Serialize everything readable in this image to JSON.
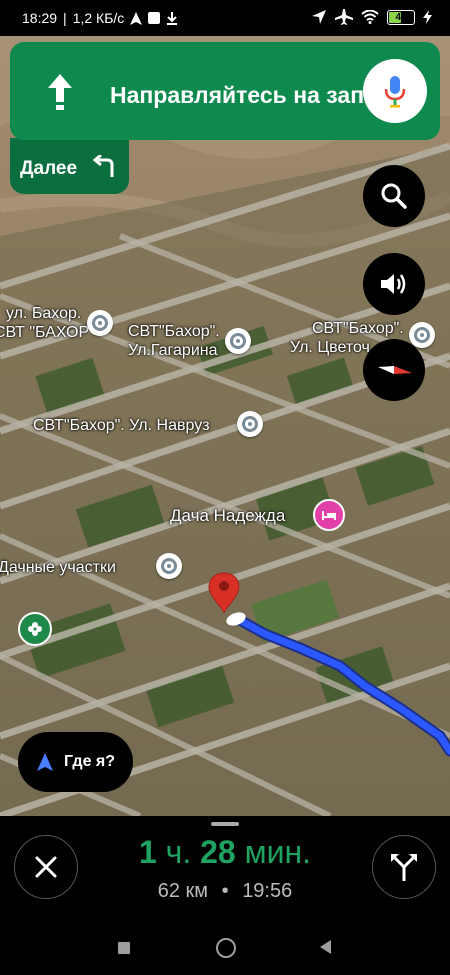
{
  "status_bar": {
    "time": "18:29",
    "speed": "1,2 КБ/с",
    "battery": "46"
  },
  "banner": {
    "instruction": "Направляйтесь на запад",
    "next_label": "Далее"
  },
  "map_labels": {
    "label_1": "ул. Бахор.",
    "label_2": "СВТ \"БАХОР\"",
    "label_3": "СВТ\"Бахор\".",
    "label_4": "Ул.Гагарина",
    "label_5": "СВТ\"Бахор\".",
    "label_6": "Ул. Цветоч",
    "label_7": "СВТ\"Бахор\". Ул. Навруз",
    "label_8": "Дача Надежда",
    "label_9": "Дачные участки"
  },
  "where_am_i": "Где я?",
  "trip": {
    "hours": "1",
    "hours_unit": "ч.",
    "minutes": "28",
    "minutes_unit": "мин.",
    "distance": "62 км",
    "separator": "•",
    "arrival": "19:56"
  },
  "colors": {
    "nav_green": "#0f8a4f",
    "nav_green_dark": "#0b6e3e",
    "eta_green": "#1ea362",
    "route_blue": "#2b59ff"
  },
  "icons": [
    "navigation-icon",
    "download-icon",
    "location-arrow-icon",
    "airplane-icon",
    "wifi-icon",
    "battery-icon",
    "bolt-icon",
    "straight-arrow-icon",
    "turn-left-icon",
    "mic-icon",
    "search-icon",
    "volume-icon",
    "compass-icon",
    "place-pin-icon",
    "hotel-icon",
    "park-icon",
    "destination-pin-icon",
    "close-icon",
    "alternate-routes-icon"
  ]
}
